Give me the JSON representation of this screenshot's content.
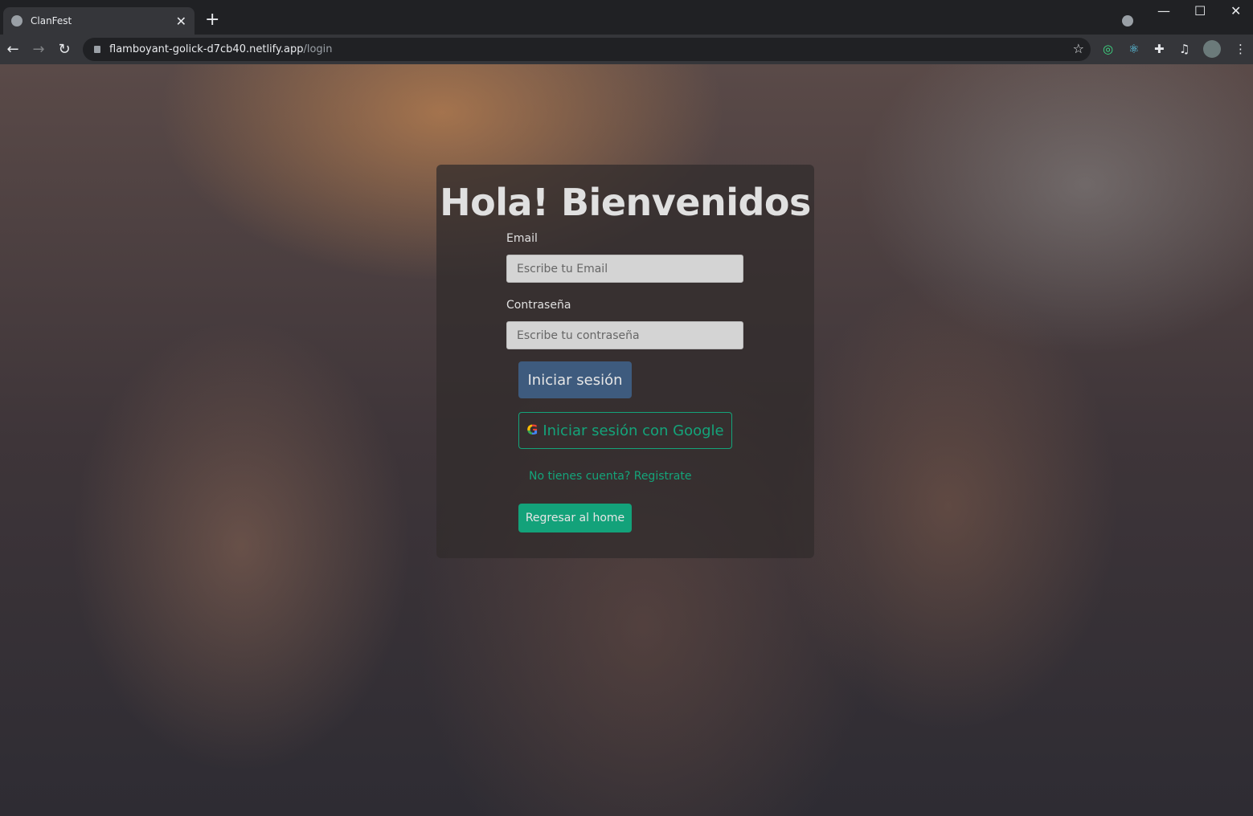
{
  "browser": {
    "tab_title": "ClanFest",
    "url_host": "flamboyant-golick-d7cb40.netlify.app",
    "url_path": "/login"
  },
  "login": {
    "heading": "Hola! Bienvenidos",
    "email_label": "Email",
    "email_placeholder": "Escribe tu Email",
    "email_value": "",
    "password_label": "Contraseña",
    "password_placeholder": "Escribe tu contraseña",
    "password_value": "",
    "login_button": "Iniciar sesión",
    "google_button": "Iniciar sesión con Google",
    "google_glyph": "G",
    "register_link": "No tienes cuenta? Registrate",
    "home_button": "Regresar al home"
  },
  "colors": {
    "accent": "#14a47a",
    "primary": "#3e5b7e"
  }
}
